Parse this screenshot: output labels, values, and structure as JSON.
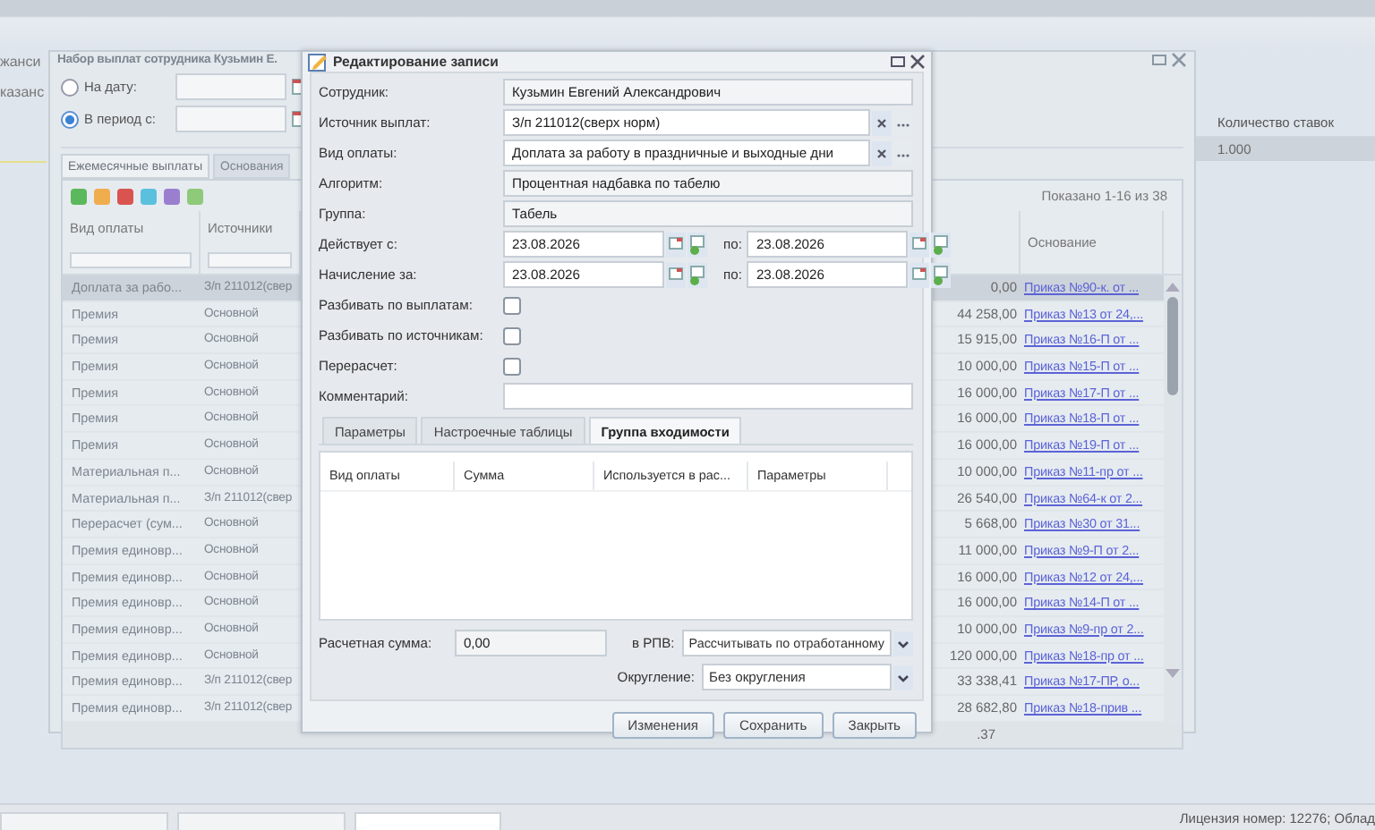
{
  "background": {
    "left_texts": [
      "жанси",
      "казанс"
    ],
    "right_grid": {
      "column": "Количество ставок",
      "value": "1.000",
      "selected": true
    }
  },
  "back_window": {
    "title": "Набор выплат сотрудника Кузьмин Е.",
    "radios": [
      {
        "label": "На дату:",
        "selected": false
      },
      {
        "label": "В период с:",
        "selected": true
      }
    ],
    "tabs": [
      {
        "label": "Ежемесячные выплаты",
        "selected": true
      },
      {
        "label": "Основания",
        "selected": false
      }
    ],
    "paging": "Показано 1-16 из 38",
    "columns": [
      "Вид оплаты",
      "Источники",
      "Основание"
    ],
    "rows": [
      {
        "payment": "Доплата за рабо...",
        "source": "З/п 211012(свер",
        "amount": "0,00",
        "basis": "Приказ №90-к. от ...",
        "selected": true
      },
      {
        "payment": "Премия",
        "source": "Основной",
        "amount": "44 258,00",
        "basis": "Приказ №13 от 24,...",
        "selected": false
      },
      {
        "payment": "Премия",
        "source": "Основной",
        "amount": "15 915,00",
        "basis": "Приказ №16-П от ...",
        "selected": false
      },
      {
        "payment": "Премия",
        "source": "Основной",
        "amount": "10 000,00",
        "basis": "Приказ №15-П от ...",
        "selected": false
      },
      {
        "payment": "Премия",
        "source": "Основной",
        "amount": "16 000,00",
        "basis": "Приказ №17-П от ...",
        "selected": false
      },
      {
        "payment": "Премия",
        "source": "Основной",
        "amount": "16 000,00",
        "basis": "Приказ №18-П от ...",
        "selected": false
      },
      {
        "payment": "Премия",
        "source": "Основной",
        "amount": "16 000,00",
        "basis": "Приказ №19-П от ...",
        "selected": false
      },
      {
        "payment": "Материальная п...",
        "source": "Основной",
        "amount": "10 000,00",
        "basis": "Приказ №11-пр от ...",
        "selected": false
      },
      {
        "payment": "Материальная п...",
        "source": "З/п 211012(свер",
        "amount": "26 540,00",
        "basis": "Приказ №64-к от 2...",
        "selected": false
      },
      {
        "payment": "Перерасчет (сум...",
        "source": "Основной",
        "amount": "5 668,00",
        "basis": "Приказ №30 от 31...",
        "selected": false
      },
      {
        "payment": "Премия единовр...",
        "source": "Основной",
        "amount": "11 000,00",
        "basis": "Приказ №9-П от 2...",
        "selected": false
      },
      {
        "payment": "Премия единовр...",
        "source": "Основной",
        "amount": "16 000,00",
        "basis": "Приказ №12 от 24,...",
        "selected": false
      },
      {
        "payment": "Премия единовр...",
        "source": "Основной",
        "amount": "16 000,00",
        "basis": "Приказ №14-П от ...",
        "selected": false
      },
      {
        "payment": "Премия единовр...",
        "source": "Основной",
        "amount": "10 000,00",
        "basis": "Приказ №9-пр от 2...",
        "selected": false
      },
      {
        "payment": "Премия единовр...",
        "source": "Основной",
        "amount": "120 000,00",
        "basis": "Приказ №18-пр от ...",
        "selected": false
      },
      {
        "payment": "Премия единовр...",
        "source": "З/п 211012(свер",
        "amount": "33 338,41",
        "basis": "Приказ №17-ПР, о...",
        "selected": false
      },
      {
        "payment": "Премия единовр...",
        "source": "З/п 211012(свер",
        "amount": "28 682,80",
        "basis": "Приказ №18-прив ...",
        "selected": false
      }
    ],
    "footer": ".37"
  },
  "dialog": {
    "title": "Редактирование записи",
    "fields": [
      {
        "label": "Сотрудник:",
        "kind": "readonly",
        "value": "Кузьмин Евгений Александрович"
      },
      {
        "label": "Источник выплат:",
        "kind": "lookup",
        "value": "З/п 211012(сверх норм)"
      },
      {
        "label": "Вид оплаты:",
        "kind": "lookup",
        "value": "Доплата за работу в праздничные и выходные дни"
      },
      {
        "label": "Алгоритм:",
        "kind": "readonly",
        "value": "Процентная надбавка по табелю"
      },
      {
        "label": "Группа:",
        "kind": "readonly",
        "value": "Табель"
      },
      {
        "label": "Действует с:",
        "kind": "daterange",
        "from": "23.08.2026",
        "to_label": "по:",
        "to": "23.08.2026"
      },
      {
        "label": "Начисление за:",
        "kind": "daterange",
        "from": "23.08.2026",
        "to_label": "по:",
        "to": "23.08.2026"
      },
      {
        "label": "Разбивать по выплатам:",
        "kind": "checkbox",
        "checked": false
      },
      {
        "label": "Разбивать по источникам:",
        "kind": "checkbox",
        "checked": false
      },
      {
        "label": "Перерасчет:",
        "kind": "checkbox",
        "checked": false
      },
      {
        "label": "Комментарий:",
        "kind": "text"
      }
    ],
    "tabs": [
      {
        "label": "Параметры",
        "selected": false
      },
      {
        "label": "Настроечные таблицы",
        "selected": false
      },
      {
        "label": "Группа входимости",
        "selected": true
      }
    ],
    "grid_columns": [
      "Вид оплаты",
      "Сумма",
      "Используется в рас...",
      "Параметры"
    ],
    "calc_label": "Расчетная сумма:",
    "calc_value": "0,00",
    "rpv_label": "в РПВ:",
    "rpv_value": "Рассчитывать по отработанному",
    "rounding_label": "Округление:",
    "rounding_value": "Без округления",
    "buttons": [
      "Изменения",
      "Сохранить",
      "Закрыть"
    ]
  },
  "status_bar": {
    "license": "Лицензия номер: 12276; Облад"
  }
}
